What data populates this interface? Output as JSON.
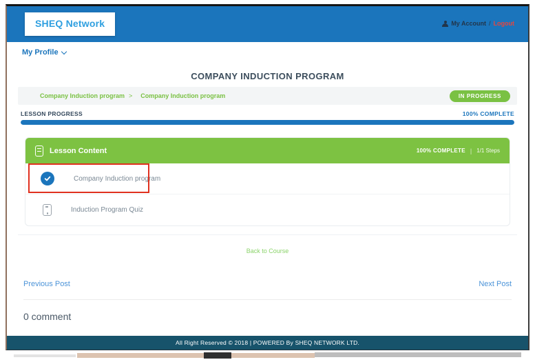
{
  "header": {
    "logo_text": "SHEQ Network",
    "account": {
      "my_account": "My Account",
      "separator": "/",
      "logout": "Logout"
    }
  },
  "nav": {
    "my_profile": "My Profile"
  },
  "page": {
    "title": "COMPANY INDUCTION PROGRAM"
  },
  "breadcrumb": {
    "items": [
      "Company Induction program",
      "Company Induction program"
    ],
    "separator": ">"
  },
  "status_badge": "IN PROGRESS",
  "lesson_progress": {
    "label": "LESSON PROGRESS",
    "complete_label": "100% COMPLETE",
    "percent": 100
  },
  "lesson_content": {
    "title": "Lesson Content",
    "complete_label": "100% COMPLETE",
    "divider": "|",
    "steps_label": "1/1 Steps",
    "items": [
      {
        "label": "Company Induction program",
        "status": "complete"
      },
      {
        "label": "Induction Program Quiz",
        "status": "incomplete"
      }
    ]
  },
  "links": {
    "back_to_course": "Back to Course",
    "previous_post": "Previous Post",
    "next_post": "Next Post"
  },
  "comments": {
    "count_label": "0 comment"
  },
  "footer": {
    "text": "All Right Reserved  © 2018 | POWERED By SHEQ NETWORK LTD."
  },
  "colors": {
    "header_blue": "#1b75bc",
    "logo_blue": "#2e9fe0",
    "green": "#7ac143",
    "card_green": "#7dc242",
    "footer_teal": "#17536b",
    "logout_red": "#e8453c",
    "annotation_red": "#e0301e"
  }
}
